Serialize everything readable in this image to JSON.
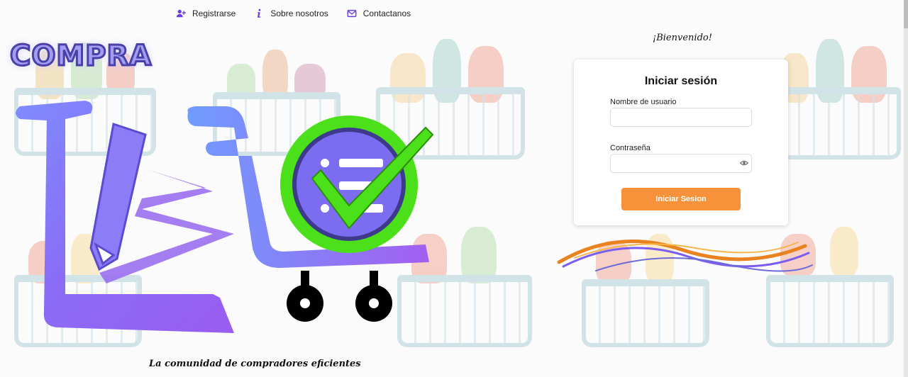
{
  "nav": {
    "items": [
      {
        "label": "Registrarse",
        "icon": "user-plus-icon"
      },
      {
        "label": "Sobre nosotros",
        "icon": "info-icon"
      },
      {
        "label": "Contactanos",
        "icon": "envelope-icon"
      }
    ],
    "icon_color": "#6c3ce0"
  },
  "brand": {
    "logo_text": "COMPRA",
    "tagline": "La comunidad de compradores eficientes"
  },
  "login": {
    "welcome": "¡Bienvenido!",
    "title": "Iniciar sesión",
    "username_label": "Nombre de usuario",
    "username_value": "",
    "password_label": "Contraseña",
    "password_value": "",
    "submit_label": "Iniciar Sesion"
  },
  "colors": {
    "accent_button": "#f7923a",
    "logo_purple": "#7b6cf5",
    "check_green": "#4be01a"
  }
}
